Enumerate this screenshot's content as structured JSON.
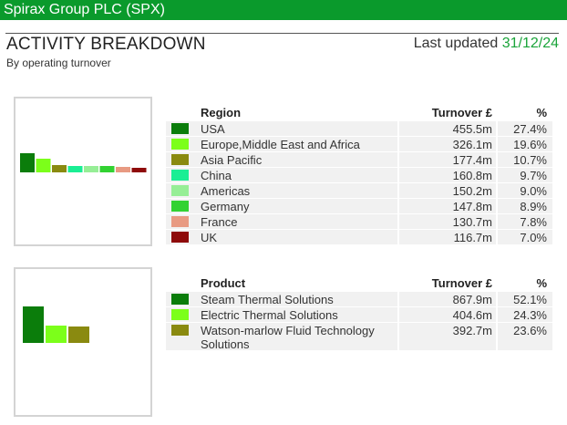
{
  "header": {
    "company": "Spirax Group PLC (SPX)",
    "title": "ACTIVITY BREAKDOWN",
    "subtitle": "By operating turnover",
    "last_updated_label": "Last updated",
    "last_updated_date": "31/12/24"
  },
  "region_table": {
    "col_name": "Region",
    "col_turnover": "Turnover £",
    "col_pct": "%",
    "rows": [
      {
        "name": "USA",
        "turnover": "455.5m",
        "pct": "27.4%",
        "color": "#0b7d0b"
      },
      {
        "name": "Europe,Middle East and Africa",
        "turnover": "326.1m",
        "pct": "19.6%",
        "color": "#7cff1a"
      },
      {
        "name": "Asia Pacific",
        "turnover": "177.4m",
        "pct": "10.7%",
        "color": "#8a8a10"
      },
      {
        "name": "China",
        "turnover": "160.8m",
        "pct": "9.7%",
        "color": "#1aee94"
      },
      {
        "name": "Americas",
        "turnover": "150.2m",
        "pct": "9.0%",
        "color": "#96ee96"
      },
      {
        "name": "Germany",
        "turnover": "147.8m",
        "pct": "8.9%",
        "color": "#32d232"
      },
      {
        "name": "France",
        "turnover": "130.7m",
        "pct": "7.8%",
        "color": "#e89a82"
      },
      {
        "name": "UK",
        "turnover": "116.7m",
        "pct": "7.0%",
        "color": "#8e0a0a"
      }
    ]
  },
  "product_table": {
    "col_name": "Product",
    "col_turnover": "Turnover £",
    "col_pct": "%",
    "rows": [
      {
        "name": "Steam Thermal Solutions",
        "turnover": "867.9m",
        "pct": "52.1%",
        "color": "#0b7d0b"
      },
      {
        "name": "Electric Thermal Solutions",
        "turnover": "404.6m",
        "pct": "24.3%",
        "color": "#7cff1a"
      },
      {
        "name": "Watson-marlow Fluid Technology Solutions",
        "turnover": "392.7m",
        "pct": "23.6%",
        "color": "#8a8a10"
      }
    ]
  },
  "chart_data": [
    {
      "type": "bar",
      "categories": [
        "USA",
        "Europe,Middle East and Africa",
        "Asia Pacific",
        "China",
        "Americas",
        "Germany",
        "France",
        "UK"
      ],
      "values": [
        455.5,
        326.1,
        177.4,
        160.8,
        150.2,
        147.8,
        130.7,
        116.7
      ],
      "colors": [
        "#0b7d0b",
        "#7cff1a",
        "#8a8a10",
        "#1aee94",
        "#96ee96",
        "#32d232",
        "#e89a82",
        "#8e0a0a"
      ],
      "title": "",
      "xlabel": "",
      "ylabel": "",
      "grid": false
    },
    {
      "type": "bar",
      "categories": [
        "Steam Thermal Solutions",
        "Electric Thermal Solutions",
        "Watson-marlow Fluid Technology Solutions"
      ],
      "values": [
        867.9,
        404.6,
        392.7
      ],
      "colors": [
        "#0b7d0b",
        "#7cff1a",
        "#8a8a10"
      ],
      "title": "",
      "xlabel": "",
      "ylabel": "",
      "grid": false
    }
  ]
}
